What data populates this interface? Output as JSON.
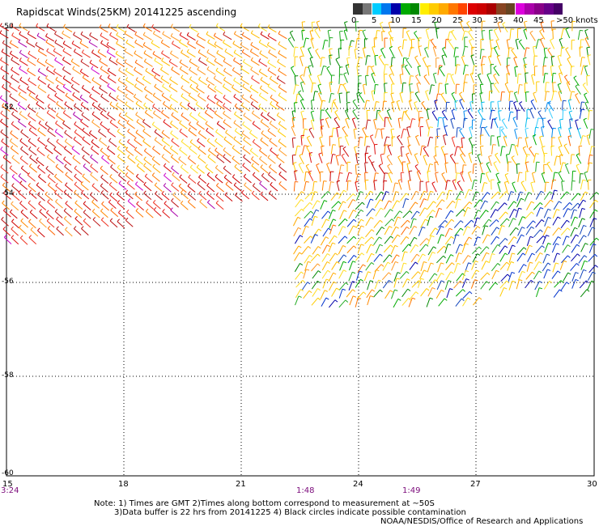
{
  "title": "Rapidscat Winds(25KM) 20141225 ascending",
  "legend": {
    "labels": [
      "0",
      "5",
      "10",
      "15",
      "20",
      "25",
      "30",
      "35",
      "40",
      "45",
      ">50 knots"
    ],
    "colors": [
      "#333333",
      "#777777",
      "#00ccff",
      "#0077ee",
      "#0000aa",
      "#00aa00",
      "#008800",
      "#ffee00",
      "#ffcc00",
      "#ffaa00",
      "#ff7700",
      "#ff4400",
      "#dd0000",
      "#cc0000",
      "#aa0000",
      "#884422",
      "#664422",
      "#dd00dd",
      "#aa00aa",
      "#880088",
      "#660088",
      "#440066"
    ]
  },
  "map": {
    "x_ticks": [
      "15",
      "18",
      "21",
      "24",
      "27",
      "30"
    ],
    "y_ticks": [
      "-50",
      "-52",
      "-54",
      "-56",
      "-58",
      "-60"
    ],
    "x_range": [
      15,
      30
    ],
    "y_range": [
      -60,
      -50
    ]
  },
  "times": [
    "3:24",
    "1:48",
    "1:49"
  ],
  "notes": {
    "line1": "Note: 1) Times are GMT 2)Times along bottom correspond to measurement at ~50S",
    "line2": "3)Data buffer is 22 hrs from 20141225 4) Black circles indicate possible contamination",
    "credit": "NOAA/NESDIS/Office of Research and Applications"
  }
}
